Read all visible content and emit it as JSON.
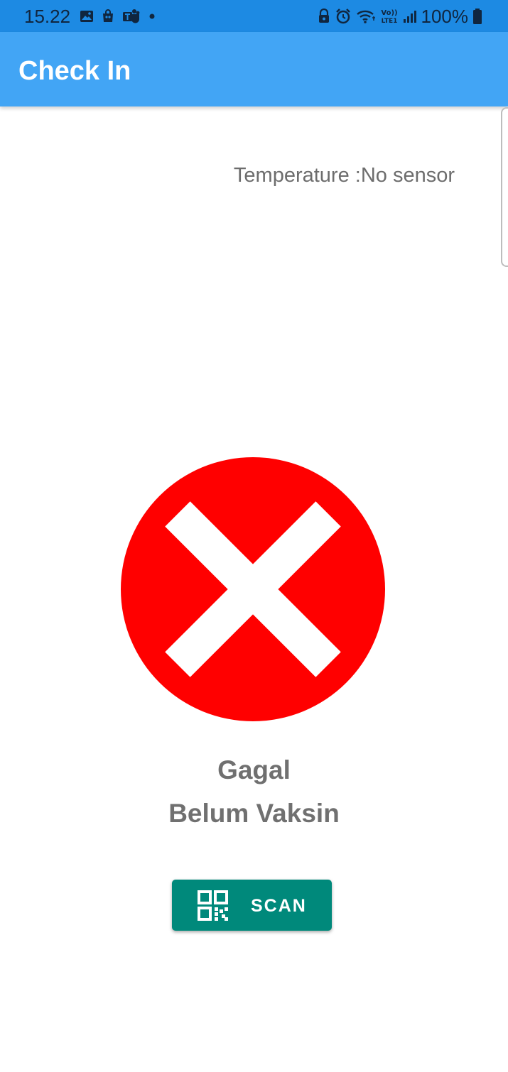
{
  "status_bar": {
    "time": "15.22",
    "battery_text": "100%",
    "left_icons": [
      "gallery-icon",
      "shopping-bag-icon",
      "teams-icon",
      "dot-icon"
    ],
    "right_icons": [
      "lock-icon",
      "alarm-icon",
      "wifi-icon",
      "volte-icon",
      "signal-icon",
      "battery-icon"
    ]
  },
  "app_bar": {
    "title": "Check In",
    "color": "#42a5f5"
  },
  "temperature": {
    "text": "Temperature :No sensor"
  },
  "result": {
    "icon": "close-circle-icon",
    "icon_color": "#ff0000",
    "title": "Gagal",
    "subtitle": "Belum Vaksin"
  },
  "scan_button": {
    "label": "SCAN",
    "icon": "qr-code-icon",
    "color": "#00897b"
  }
}
